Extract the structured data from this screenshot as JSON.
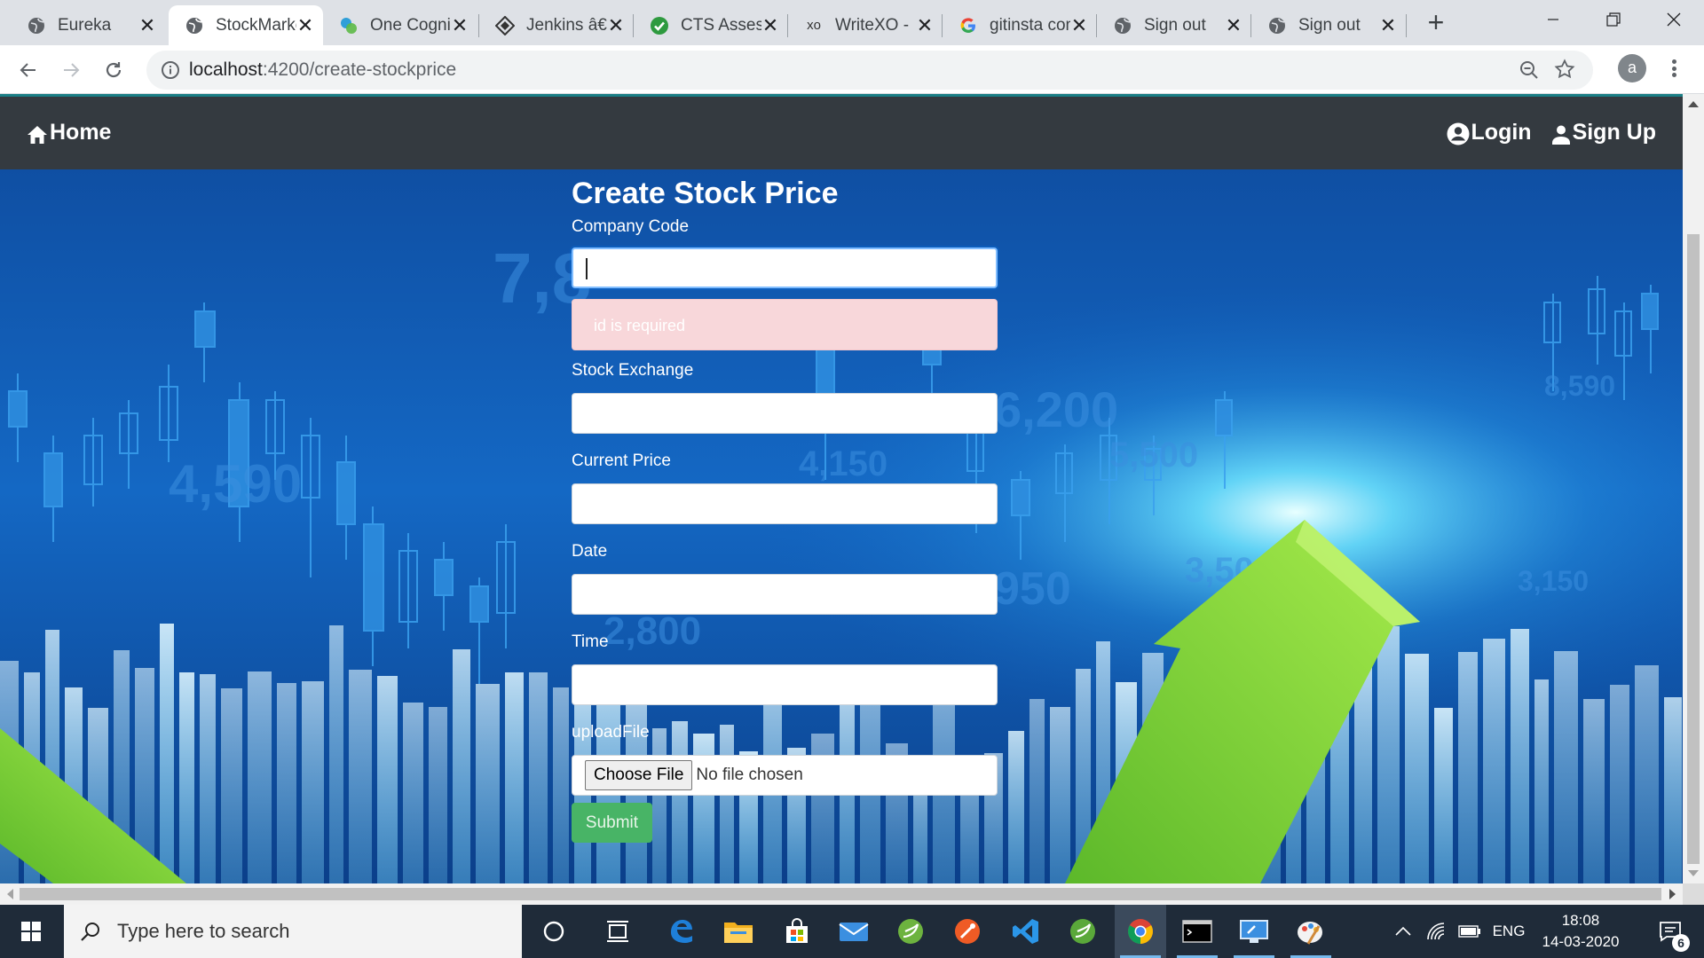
{
  "browser": {
    "tabs": [
      {
        "title": "Eureka",
        "icon": "globe-icon"
      },
      {
        "title": "StockMarket",
        "icon": "globe-icon",
        "active": true
      },
      {
        "title": "One Cognizant",
        "icon": "cognizant-icon"
      },
      {
        "title": "Jenkins â€",
        "icon": "jenkins-icon"
      },
      {
        "title": "CTS Assessment",
        "icon": "check-circle-icon"
      },
      {
        "title": "WriteXO - ",
        "icon": "xo-icon",
        "icon_text": "xo"
      },
      {
        "title": "gitinsta com",
        "icon": "google-icon"
      },
      {
        "title": "Sign out",
        "icon": "globe-icon"
      },
      {
        "title": "Sign out",
        "icon": "globe-icon"
      }
    ],
    "new_tab_label": "+",
    "url_host": "localhost",
    "url_path": ":4200/create-stockprice",
    "profile_initial": "a"
  },
  "navbar": {
    "home_label": "Home",
    "login_label": "Login",
    "signup_label": "Sign Up"
  },
  "form": {
    "title": "Create Stock Price",
    "fields": [
      {
        "label": "Company Code",
        "value": "",
        "focused": true
      },
      {
        "label": "Stock Exchange",
        "value": ""
      },
      {
        "label": "Current Price",
        "value": ""
      },
      {
        "label": "Date",
        "value": ""
      },
      {
        "label": "Time",
        "value": ""
      }
    ],
    "error_message": "id is required",
    "upload_label": "uploadFile",
    "choose_file_label": "Choose File",
    "no_file_text": "No file chosen",
    "submit_label": "Submit"
  },
  "background": {
    "numbers": [
      "7,8",
      "6,200",
      "4,590",
      "5,500",
      "4,150",
      "3,500",
      "950",
      "2,800",
      "8,590",
      "3,150"
    ]
  },
  "taskbar": {
    "search_placeholder": "Type here to search",
    "language": "ENG",
    "time": "18:08",
    "date": "14-03-2020",
    "notification_count": "6"
  },
  "colors": {
    "navbar": "#343a40",
    "alert_bg": "#f8d7da",
    "submit_bg": "#48b466",
    "taskbar": "#1f2b39"
  }
}
